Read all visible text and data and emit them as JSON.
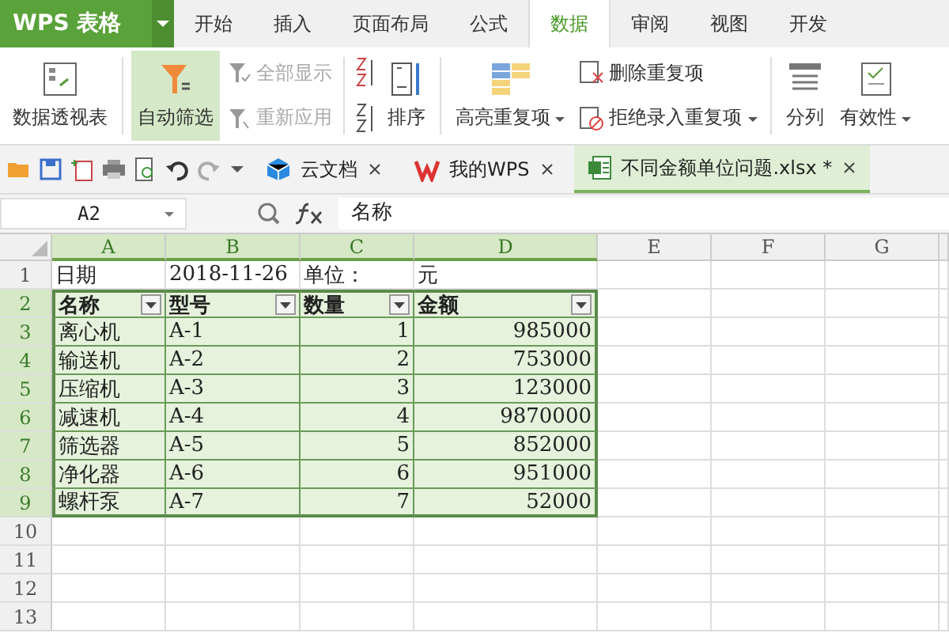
{
  "app_menu": {
    "label": "WPS 表格"
  },
  "menu_tabs": [
    {
      "label": "开始",
      "selected": false
    },
    {
      "label": "插入",
      "selected": false
    },
    {
      "label": "页面布局",
      "selected": false
    },
    {
      "label": "公式",
      "selected": false
    },
    {
      "label": "数据",
      "selected": true
    },
    {
      "label": "审阅",
      "selected": false
    },
    {
      "label": "视图",
      "selected": false
    },
    {
      "label": "开发",
      "selected": false
    }
  ],
  "ribbon": {
    "pivot": {
      "label": "数据透视表"
    },
    "autofilter": {
      "label": "自动筛选",
      "active": true
    },
    "show_all": {
      "label": "全部显示",
      "disabled": true
    },
    "reapply": {
      "label": "重新应用",
      "disabled": true
    },
    "sort": {
      "label": "排序"
    },
    "highlight_duplicates": {
      "label": "高亮重复项"
    },
    "remove_duplicates": {
      "label": "删除重复项"
    },
    "reject_duplicates": {
      "label": "拒绝录入重复项"
    },
    "text_to_columns": {
      "label": "分列"
    },
    "validation": {
      "label": "有效性"
    }
  },
  "doc_tabs": [
    {
      "kind": "cloud",
      "label": "云文档",
      "selected": false
    },
    {
      "kind": "wps",
      "label": "我的WPS",
      "selected": false
    },
    {
      "kind": "sheet",
      "label": "不同金额单位问题.xlsx *",
      "selected": true
    }
  ],
  "formula_bar": {
    "name_box": "A2",
    "formula": "名称"
  },
  "columns": [
    {
      "label": "A",
      "selected": true
    },
    {
      "label": "B",
      "selected": true
    },
    {
      "label": "C",
      "selected": true
    },
    {
      "label": "D",
      "selected": true
    },
    {
      "label": "E",
      "selected": false
    },
    {
      "label": "F",
      "selected": false
    },
    {
      "label": "G",
      "selected": false
    }
  ],
  "rows": [
    {
      "num": "1",
      "kind": "plain",
      "selected": false,
      "cells": [
        "日期",
        "2018-11-26",
        "单位：",
        "元"
      ]
    },
    {
      "num": "2",
      "kind": "header",
      "selected": true,
      "cells": [
        "名称",
        "型号",
        "数量",
        "金额"
      ]
    },
    {
      "num": "3",
      "kind": "data",
      "selected": true,
      "cells": [
        "离心机",
        "A-1",
        "1",
        "985000"
      ]
    },
    {
      "num": "4",
      "kind": "data",
      "selected": true,
      "cells": [
        "输送机",
        "A-2",
        "2",
        "753000"
      ]
    },
    {
      "num": "5",
      "kind": "data",
      "selected": true,
      "cells": [
        "压缩机",
        "A-3",
        "3",
        "123000"
      ]
    },
    {
      "num": "6",
      "kind": "data",
      "selected": true,
      "cells": [
        "减速机",
        "A-4",
        "4",
        "9870000"
      ]
    },
    {
      "num": "7",
      "kind": "data",
      "selected": true,
      "cells": [
        "筛选器",
        "A-5",
        "5",
        "852000"
      ]
    },
    {
      "num": "8",
      "kind": "data",
      "selected": true,
      "cells": [
        "净化器",
        "A-6",
        "6",
        "951000"
      ]
    },
    {
      "num": "9",
      "kind": "data",
      "selected": true,
      "cells": [
        "螺杆泵",
        "A-7",
        "7",
        "52000"
      ]
    },
    {
      "num": "10",
      "kind": "plain",
      "selected": false,
      "cells": []
    },
    {
      "num": "11",
      "kind": "plain",
      "selected": false,
      "cells": []
    },
    {
      "num": "12",
      "kind": "plain",
      "selected": false,
      "cells": []
    },
    {
      "num": "13",
      "kind": "plain",
      "selected": false,
      "cells": []
    }
  ]
}
